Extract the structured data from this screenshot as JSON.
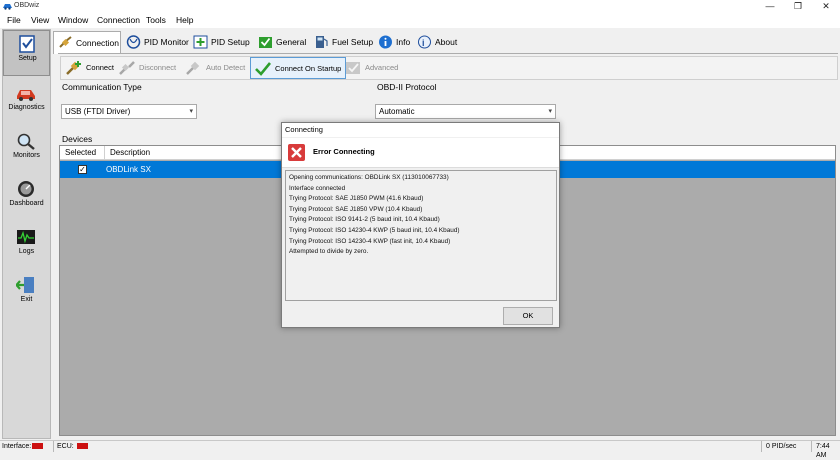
{
  "window": {
    "title": "OBDwiz",
    "controls": {
      "minimize": "—",
      "restore": "❐",
      "close": "✕"
    }
  },
  "menu": [
    "File",
    "View",
    "Window",
    "Connection",
    "Tools",
    "Help"
  ],
  "sidebar": {
    "items": [
      {
        "label": "Setup",
        "icon": "checklist-icon",
        "active": true
      },
      {
        "label": "Diagnostics",
        "icon": "car-icon",
        "active": false
      },
      {
        "label": "Monitors",
        "icon": "magnifier-icon",
        "active": false
      },
      {
        "label": "Dashboard",
        "icon": "gauge-icon",
        "active": false
      },
      {
        "label": "Logs",
        "icon": "waveform-icon",
        "active": false
      },
      {
        "label": "Exit",
        "icon": "exit-door-icon",
        "active": false
      }
    ]
  },
  "tabs": [
    {
      "label": "Connection",
      "icon": "connection-icon",
      "active": true
    },
    {
      "label": "PID Monitor",
      "icon": "stethoscope-icon",
      "active": false
    },
    {
      "label": "PID Setup",
      "icon": "plus-document-icon",
      "active": false
    },
    {
      "label": "General",
      "icon": "checkbook-icon",
      "active": false
    },
    {
      "label": "Fuel Setup",
      "icon": "fuel-icon",
      "active": false
    },
    {
      "label": "Info",
      "icon": "info-icon",
      "active": false
    },
    {
      "label": "About",
      "icon": "about-icon",
      "active": false
    }
  ],
  "toolbar": {
    "connect": "Connect",
    "disconnect": "Disconnect",
    "auto_detect": "Auto Detect",
    "connect_on_startup": "Connect On Startup",
    "advanced": "Advanced"
  },
  "connection": {
    "comm_type_label": "Communication Type",
    "comm_type_value": "USB (FTDI Driver)",
    "protocol_label": "OBD-II Protocol",
    "protocol_value": "Automatic",
    "devices_label": "Devices"
  },
  "devices_table": {
    "columns": [
      "Selected",
      "Description"
    ],
    "rows": [
      {
        "selected": true,
        "check_glyph": "✓",
        "description": "OBDLink SX"
      }
    ]
  },
  "dialog": {
    "title": "Connecting",
    "heading": "Error Connecting",
    "log": [
      "Opening communications: OBDLink SX (113010067733)",
      "Interface connected",
      "Trying Protocol: SAE J1850 PWM (41.6 Kbaud)",
      "Trying Protocol: SAE J1850 VPW (10.4 Kbaud)",
      "Trying Protocol: ISO 9141-2 (5 baud init, 10.4 Kbaud)",
      "Trying Protocol: ISO 14230-4 KWP (5 baud init, 10.4 Kbaud)",
      "Trying Protocol: ISO 14230-4 KWP (fast init, 10.4 Kbaud)",
      "Attempted to divide by zero."
    ],
    "ok_label": "OK"
  },
  "statusbar": {
    "interface_label": "Interface:",
    "ecu_label": "ECU:",
    "pid_rate": "0 PID/sec",
    "time": "7:44 AM",
    "status_color": "#cc1111"
  },
  "colors": {
    "accent": "#0078d7",
    "error": "#d83b3b",
    "success": "#2e9e2e"
  }
}
